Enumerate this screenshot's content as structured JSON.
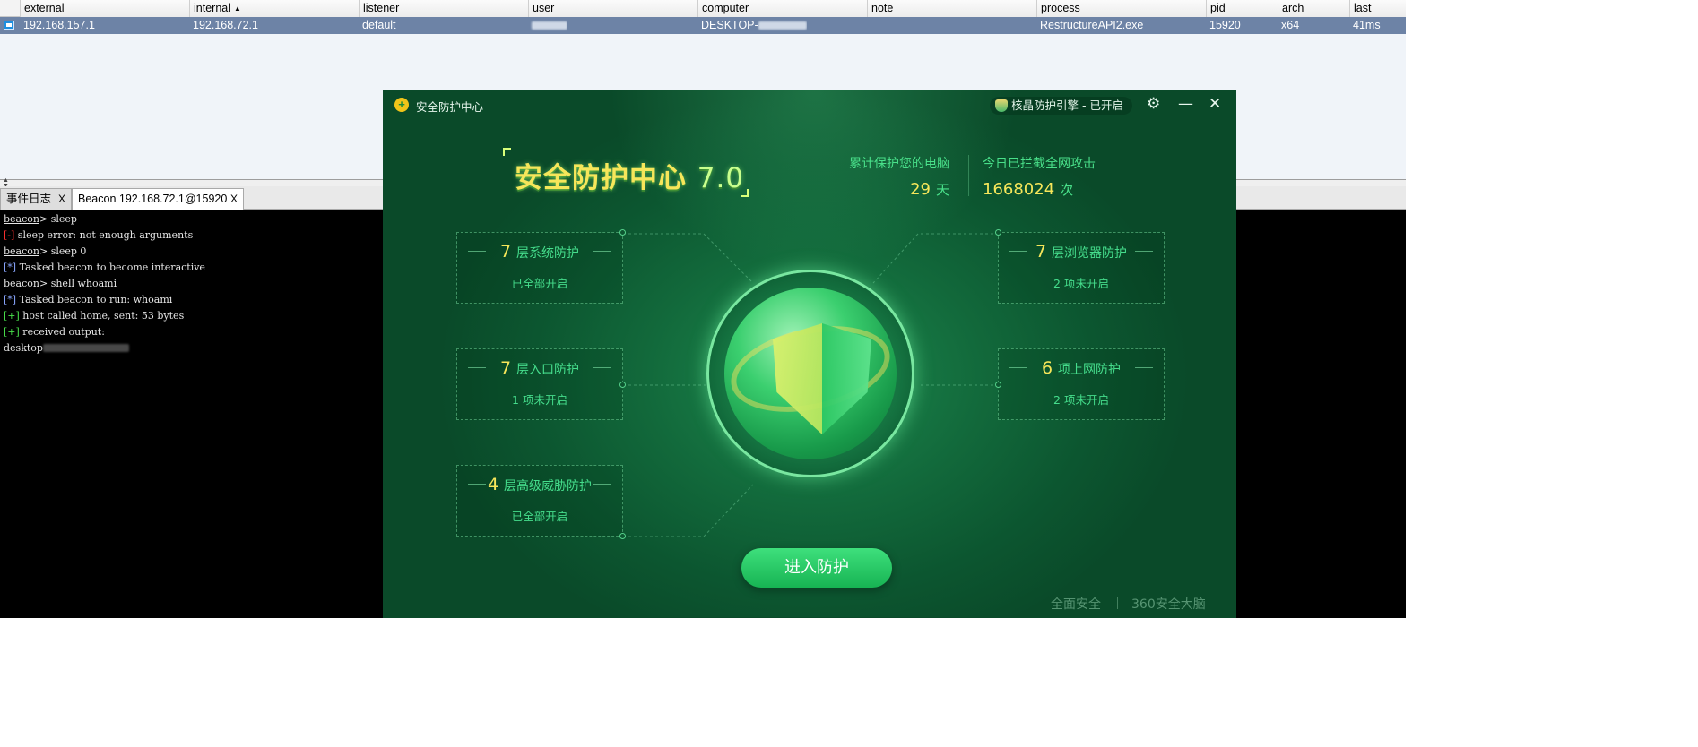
{
  "table": {
    "columns": [
      "external",
      "internal",
      "listener",
      "user",
      "computer",
      "note",
      "process",
      "pid",
      "arch",
      "last"
    ],
    "sort_indicator": "▲",
    "row": {
      "external": "192.168.157.1",
      "internal": "192.168.72.1",
      "listener": "default",
      "user": "",
      "computer": "DESKTOP-",
      "note": "",
      "process": "RestructureAPI2.exe",
      "pid": "15920",
      "arch": "x64",
      "last": "41ms"
    }
  },
  "tabs": [
    {
      "label": "事件日志",
      "close": "X"
    },
    {
      "label": "Beacon 192.168.72.1@15920",
      "close": "X"
    }
  ],
  "console": {
    "lines": [
      {
        "prompt": "beacon",
        "sep": ">",
        "text": " sleep"
      },
      {
        "tag": "[-]",
        "text": " sleep error: not enough arguments"
      },
      {
        "prompt": "beacon",
        "sep": ">",
        "text": " sleep 0"
      },
      {
        "tag": "[*]",
        "text": " Tasked beacon to become interactive"
      },
      {
        "prompt": "beacon",
        "sep": ">",
        "text": " shell whoami"
      },
      {
        "tag": "[*]",
        "text": " Tasked beacon to run: whoami"
      },
      {
        "tag": "[+]",
        "text": " host called home, sent: 53 bytes"
      },
      {
        "tag": "[+]",
        "text": " received output:"
      },
      {
        "text": "desktop"
      }
    ]
  },
  "security_window": {
    "title": "安全防护中心",
    "engine_status": "核晶防护引擎 - 已开启",
    "controls": {
      "settings": "⚙",
      "minimize": "—",
      "close": "✕"
    },
    "big_title": "安全防护中心",
    "version": "7.0",
    "stats": {
      "protect_label": "累计保护您的电脑",
      "protect_days": "29",
      "protect_unit": "天",
      "block_label": "今日已拦截全网攻击",
      "block_count": "1668024",
      "block_unit": "次"
    },
    "cards": [
      {
        "num": "7",
        "label": "层系统防护",
        "status": "已全部开启"
      },
      {
        "num": "7",
        "label": "层入口防护",
        "status": "1 项未开启"
      },
      {
        "num": "4",
        "label": "层高级威胁防护",
        "status": "已全部开启"
      },
      {
        "num": "7",
        "label": "层浏览器防护",
        "status": "2 项未开启"
      },
      {
        "num": "6",
        "label": "项上网防护",
        "status": "2 项未开启"
      }
    ],
    "enter_button": "进入防护",
    "footer_left": "全面安全",
    "footer_right": "360安全大脑",
    "accent_color": "#45dd8c",
    "highlight_color": "#f6e65a"
  }
}
